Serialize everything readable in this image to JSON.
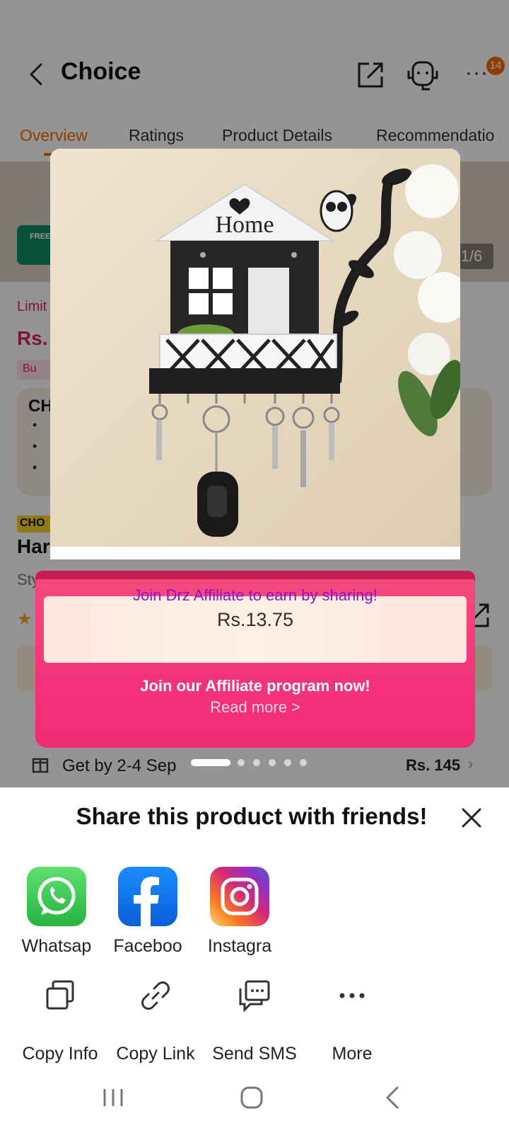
{
  "header": {
    "title": "Choice",
    "notification_count": "14"
  },
  "tabs": [
    {
      "label": "Overview"
    },
    {
      "label": "Ratings"
    },
    {
      "label": "Product Details"
    },
    {
      "label": "Recommendatio"
    }
  ],
  "gallery": {
    "counter": "1/6",
    "free_badge": "FREE",
    "page_count": 6,
    "active_page": 1
  },
  "background_page": {
    "limit_text": "Limit",
    "price_prefix": "Rs.",
    "promo_chip": "Bu",
    "choice_box_title": "CH",
    "choice_tag": "CHO",
    "product_name_fragment": "Har",
    "style_fragment": "Sty",
    "delivery": {
      "text": "Get by 2-4 Sep",
      "price": "Rs. 145"
    }
  },
  "product_image": {
    "sign_text": "Home"
  },
  "affiliate": {
    "title": "Join Drz Affiliate to earn by sharing!",
    "amount": "Rs.13.75",
    "cta": "Join our Affiliate program now!",
    "read_more": "Read more >"
  },
  "share_sheet": {
    "title": "Share this product with friends!",
    "apps": [
      {
        "label": "Whatsap",
        "icon": "whatsapp-icon",
        "color": "#25D366"
      },
      {
        "label": "Faceboo",
        "icon": "facebook-icon",
        "color": "#1877F2"
      },
      {
        "label": "Instagra",
        "icon": "instagram-icon",
        "color": "#E1306C"
      }
    ],
    "actions": [
      {
        "label": "Copy Info",
        "icon": "copy-icon"
      },
      {
        "label": "Copy Link",
        "icon": "link-icon"
      },
      {
        "label": "Send SMS",
        "icon": "sms-icon"
      },
      {
        "label": "More",
        "icon": "more-icon"
      }
    ]
  },
  "colors": {
    "accent_orange": "#f36d00",
    "affiliate_pink": "#f4337a",
    "affiliate_purple": "#8b15c8"
  }
}
